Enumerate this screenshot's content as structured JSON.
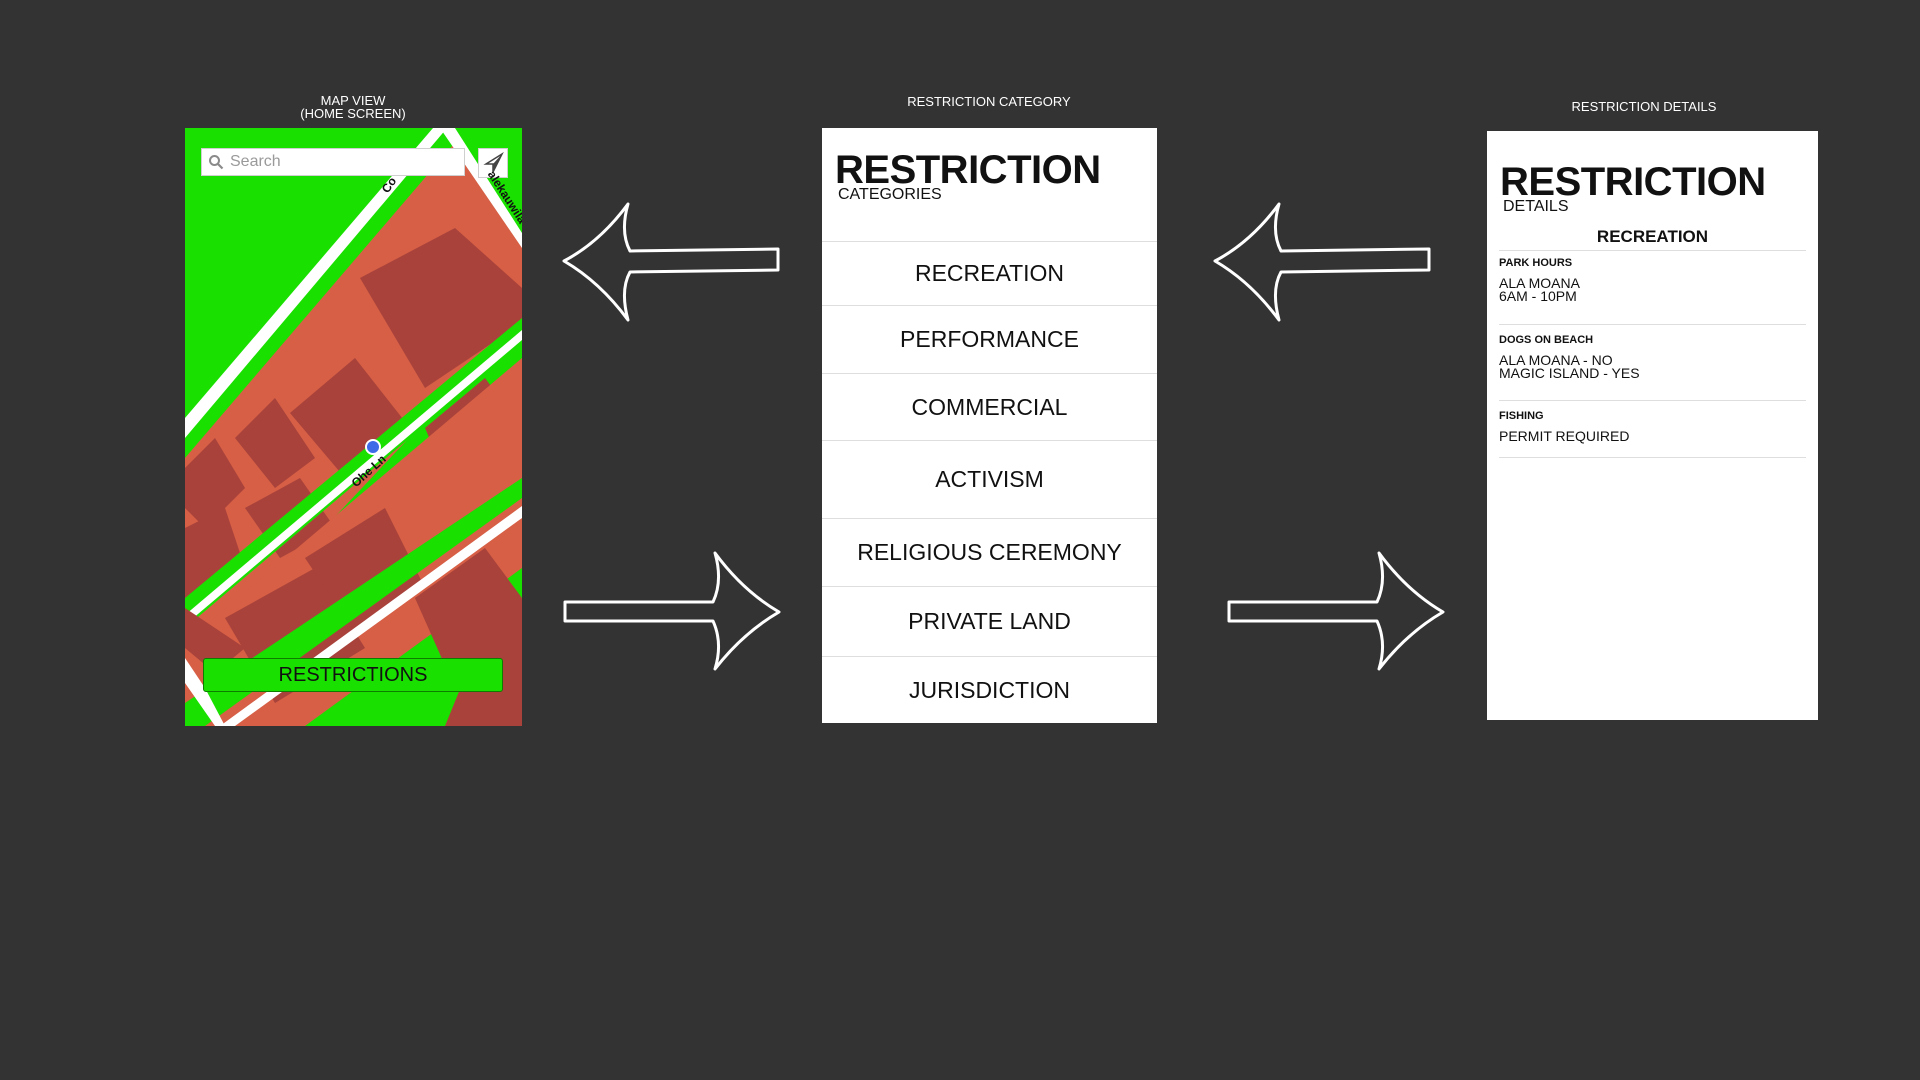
{
  "screens": {
    "map": {
      "caption_line1": "MAP VIEW",
      "caption_line2": "(HOME SCREEN)",
      "search_placeholder": "Search",
      "street_labels": {
        "main": "Ohe Ln",
        "top_left": "Co",
        "top_right": "alekauwila"
      },
      "restrictions_button": "RESTRICTIONS"
    },
    "category": {
      "caption": "RESTRICTION CATEGORY",
      "title": "RESTRICTION",
      "subtitle": "CATEGORIES",
      "items": [
        "RECREATION",
        "PERFORMANCE",
        "COMMERCIAL",
        "ACTIVISM",
        "RELIGIOUS CEREMONY",
        "PRIVATE LAND",
        "JURISDICTION"
      ]
    },
    "details": {
      "caption": "RESTRICTION DETAILS",
      "title": "RESTRICTION",
      "subtitle": "DETAILS",
      "category": "RECREATION",
      "sections": [
        {
          "heading": "PARK HOURS",
          "lines": [
            "ALA MOANA",
            "6AM - 10PM"
          ]
        },
        {
          "heading": "DOGS ON BEACH",
          "lines": [
            "ALA MOANA - NO",
            "MAGIC ISLAND - YES"
          ]
        },
        {
          "heading": "FISHING",
          "lines": [
            "PERMIT REQUIRED"
          ]
        }
      ]
    }
  },
  "colors": {
    "background": "#333333",
    "map_green": "#1ae000",
    "map_block": "#d65f45",
    "map_building": "#a8423b",
    "map_road": "#ffffff",
    "location_dot": "#3d6be8"
  },
  "icons": {
    "search": "search-icon",
    "locate": "navigation-arrow-icon",
    "flow_arrows": [
      "arrow-left-icon",
      "arrow-left-icon",
      "arrow-right-icon",
      "arrow-right-icon"
    ]
  }
}
